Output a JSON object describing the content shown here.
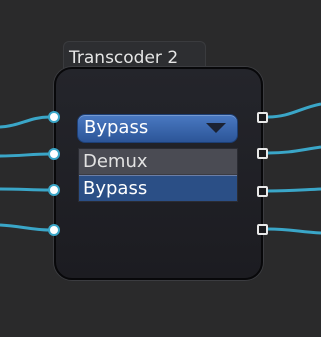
{
  "node": {
    "title": "Transcoder 2",
    "mode_select": {
      "value": "Bypass",
      "options": [
        {
          "label": "Demux"
        },
        {
          "label": "Bypass",
          "selected": true
        }
      ]
    },
    "input_ports": 4,
    "output_ports": 4
  },
  "colors": {
    "background": "#2a2a2b",
    "wire": "#3aa6c8",
    "select_accent": "#2c5598",
    "node_body": "#1c1c21",
    "selected_option": "#2b4f86"
  }
}
